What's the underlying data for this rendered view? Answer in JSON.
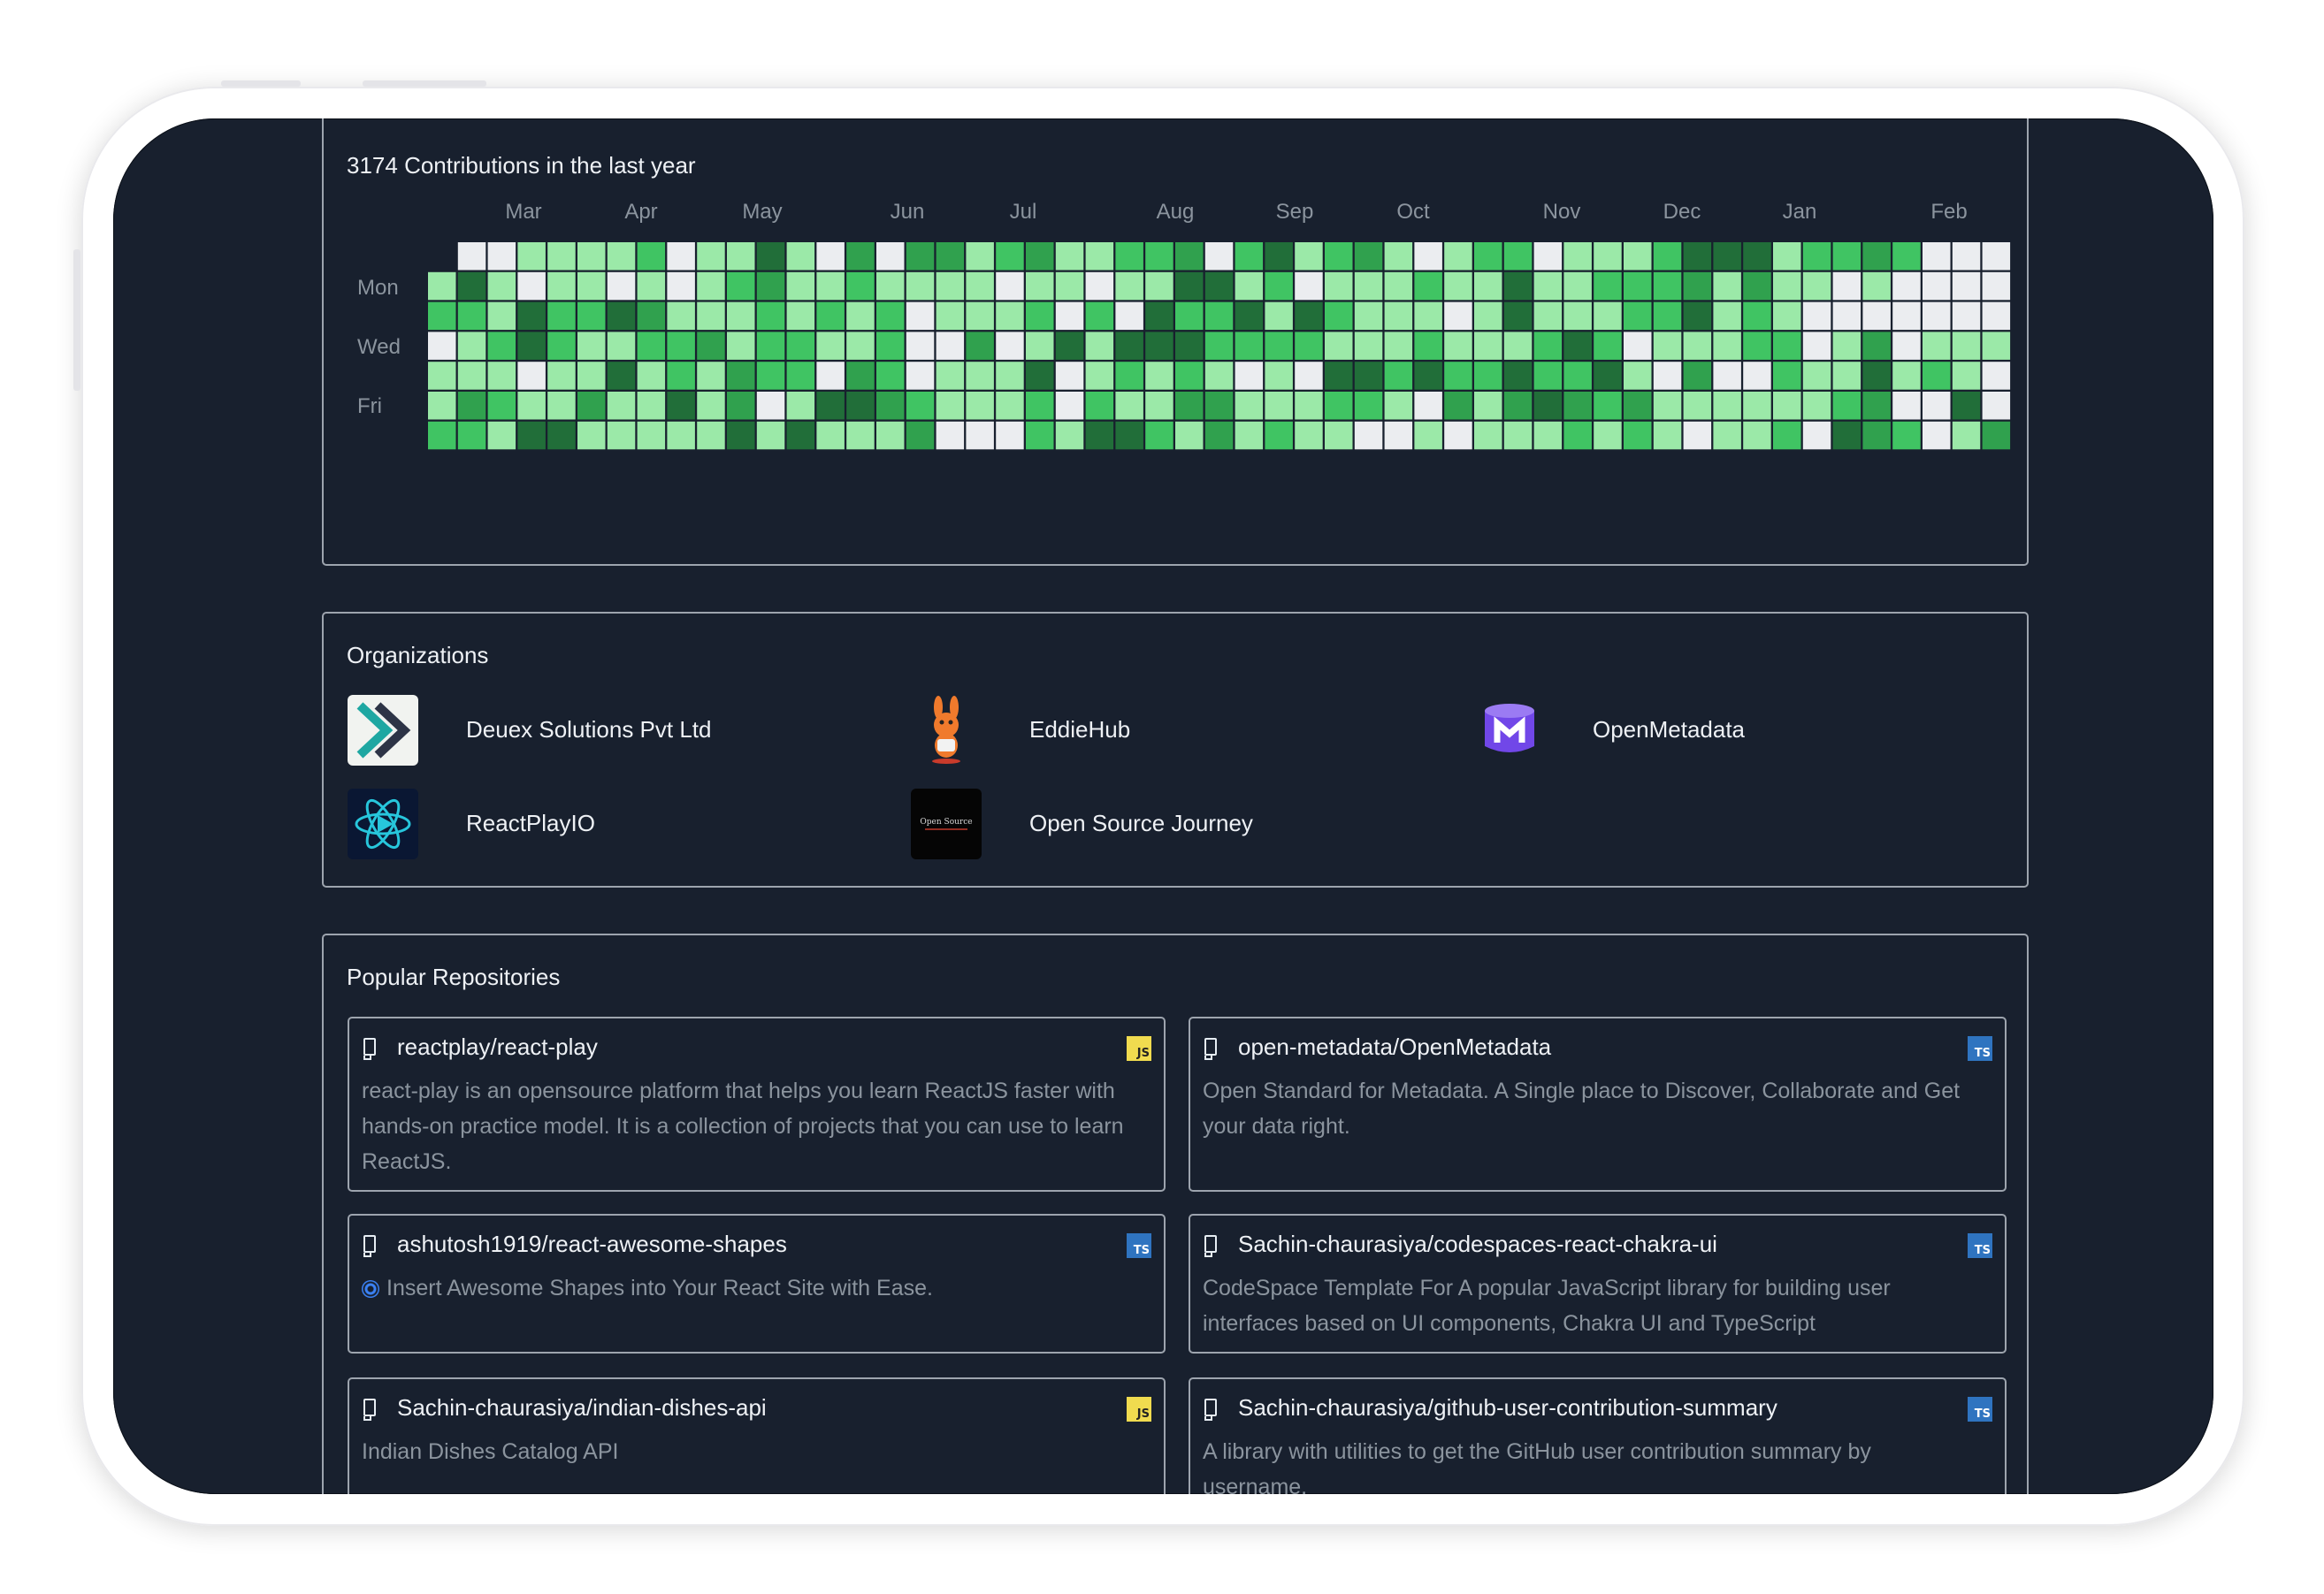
{
  "contributions": {
    "title": "3174 Contributions in the last year",
    "months": [
      "Mar",
      "Apr",
      "May",
      "Jun",
      "Jul",
      "Aug",
      "Sep",
      "Oct",
      "Nov",
      "Dec",
      "Jan",
      "Feb"
    ],
    "days": [
      "Mon",
      "Wed",
      "Fri"
    ],
    "colors": {
      "empty": "#ebedf0",
      "l1": "#9be9a8",
      "l2": "#40c463",
      "l3": "#30a14e",
      "l4": "#216e39"
    }
  },
  "organizations": {
    "title": "Organizations",
    "items": [
      {
        "name": "Deuex Solutions Pvt Ltd",
        "logo": "deuex-logo"
      },
      {
        "name": "EddieHub",
        "logo": "eddiehub-logo"
      },
      {
        "name": "OpenMetadata",
        "logo": "openmetadata-logo"
      },
      {
        "name": "ReactPlayIO",
        "logo": "reactplay-logo"
      },
      {
        "name": "Open Source Journey",
        "logo": "open-source-journey-logo",
        "logo_text": "Open Source"
      }
    ]
  },
  "repositories": {
    "title": "Popular Repositories",
    "items": [
      {
        "name": "reactplay/react-play",
        "lang": "JS",
        "desc": "react-play is an opensource platform that helps you learn ReactJS faster with hands-on practice model. It is a collection of projects that you can use to learn ReactJS."
      },
      {
        "name": "open-metadata/OpenMetadata",
        "lang": "TS",
        "desc": "Open Standard for Metadata. A Single place to Discover, Collaborate and Get your data right."
      },
      {
        "name": "ashutosh1919/react-awesome-shapes",
        "lang": "TS",
        "desc": "Insert Awesome Shapes into Your React Site with Ease."
      },
      {
        "name": "Sachin-chaurasiya/codespaces-react-chakra-ui",
        "lang": "TS",
        "desc": "CodeSpace Template For A popular JavaScript library for building user interfaces based on UI components, Chakra UI and TypeScript"
      },
      {
        "name": "Sachin-chaurasiya/indian-dishes-api",
        "lang": "JS",
        "desc": "Indian Dishes Catalog API"
      },
      {
        "name": "Sachin-chaurasiya/github-user-contribution-summary",
        "lang": "TS",
        "desc": "A library with utilities to get the GitHub user contribution summary by username."
      }
    ]
  }
}
